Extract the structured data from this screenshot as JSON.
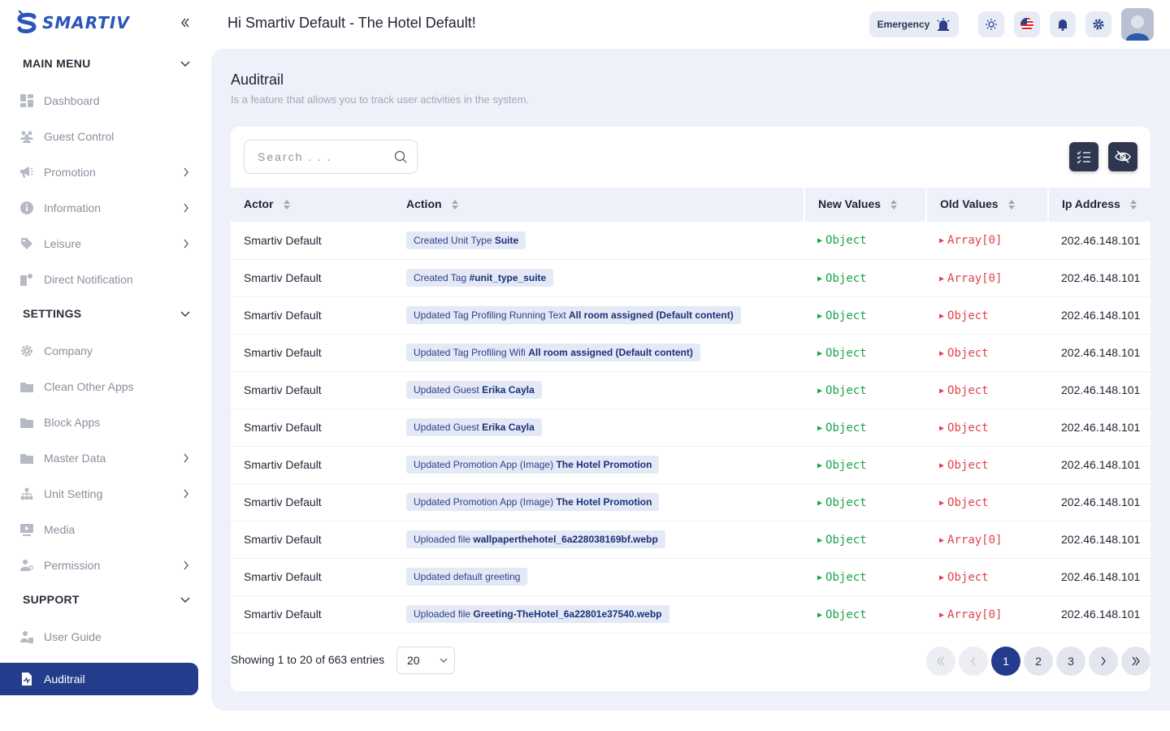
{
  "app": {
    "logo_text": "SMARTIV",
    "brand_color": "#233d8c"
  },
  "header": {
    "greeting": "Hi Smartiv Default - The Hotel Default!",
    "emergency_label": "Emergency"
  },
  "sidebar": {
    "sections": [
      {
        "title": "MAIN MENU",
        "items": [
          {
            "label": "Dashboard",
            "icon": "dashboard-icon",
            "has_chevron": false
          },
          {
            "label": "Guest Control",
            "icon": "users-icon",
            "has_chevron": false
          },
          {
            "label": "Promotion",
            "icon": "megaphone-icon",
            "has_chevron": true
          },
          {
            "label": "Information",
            "icon": "info-icon",
            "has_chevron": true
          },
          {
            "label": "Leisure",
            "icon": "tag-icon",
            "has_chevron": true
          },
          {
            "label": "Direct Notification",
            "icon": "notification-icon",
            "has_chevron": false
          }
        ]
      },
      {
        "title": "SETTINGS",
        "items": [
          {
            "label": "Company",
            "icon": "gear-icon",
            "has_chevron": false
          },
          {
            "label": "Clean Other Apps",
            "icon": "folder-icon",
            "has_chevron": false
          },
          {
            "label": "Block Apps",
            "icon": "folder-icon",
            "has_chevron": false
          },
          {
            "label": "Master Data",
            "icon": "folder-icon",
            "has_chevron": true
          },
          {
            "label": "Unit Setting",
            "icon": "hierarchy-icon",
            "has_chevron": true
          },
          {
            "label": "Media",
            "icon": "media-icon",
            "has_chevron": false
          },
          {
            "label": "Permission",
            "icon": "user-key-icon",
            "has_chevron": true
          }
        ]
      },
      {
        "title": "SUPPORT",
        "items": [
          {
            "label": "User Guide",
            "icon": "user-guide-icon",
            "has_chevron": false
          }
        ]
      }
    ],
    "active_item": {
      "label": "Auditrail",
      "icon": "auditrail-icon"
    }
  },
  "page": {
    "title": "Auditrail",
    "subtitle": "Is a feature that allows you to track user activities in the system."
  },
  "search": {
    "placeholder": "Search . . ."
  },
  "table": {
    "columns": [
      "Actor",
      "Action",
      "New Values",
      "Old Values",
      "Ip Address"
    ],
    "rows": [
      {
        "actor": "Smartiv Default",
        "action_prefix": "Created Unit Type ",
        "action_bold": "Suite",
        "new_value": "Object",
        "old_value": "Array[0]",
        "ip": "202.46.148.101"
      },
      {
        "actor": "Smartiv Default",
        "action_prefix": "Created Tag ",
        "action_bold": "#unit_type_suite",
        "new_value": "Object",
        "old_value": "Array[0]",
        "ip": "202.46.148.101"
      },
      {
        "actor": "Smartiv Default",
        "action_prefix": "Updated Tag Profiling Running Text ",
        "action_bold": "All room assigned (Default content)",
        "new_value": "Object",
        "old_value": "Object",
        "ip": "202.46.148.101"
      },
      {
        "actor": "Smartiv Default",
        "action_prefix": "Updated Tag Profiling Wifi ",
        "action_bold": "All room assigned (Default content)",
        "new_value": "Object",
        "old_value": "Object",
        "ip": "202.46.148.101"
      },
      {
        "actor": "Smartiv Default",
        "action_prefix": "Updated Guest ",
        "action_bold": "Erika Cayla",
        "new_value": "Object",
        "old_value": "Object",
        "ip": "202.46.148.101"
      },
      {
        "actor": "Smartiv Default",
        "action_prefix": "Updated Guest ",
        "action_bold": "Erika Cayla",
        "new_value": "Object",
        "old_value": "Object",
        "ip": "202.46.148.101"
      },
      {
        "actor": "Smartiv Default",
        "action_prefix": "Updated Promotion App (Image) ",
        "action_bold": "The Hotel Promotion",
        "new_value": "Object",
        "old_value": "Object",
        "ip": "202.46.148.101"
      },
      {
        "actor": "Smartiv Default",
        "action_prefix": "Updated Promotion App (Image) ",
        "action_bold": "The Hotel Promotion",
        "new_value": "Object",
        "old_value": "Object",
        "ip": "202.46.148.101"
      },
      {
        "actor": "Smartiv Default",
        "action_prefix": "Uploaded file ",
        "action_bold": "wallpaperthehotel_6a228038169bf.webp",
        "new_value": "Object",
        "old_value": "Array[0]",
        "ip": "202.46.148.101"
      },
      {
        "actor": "Smartiv Default",
        "action_prefix": "Updated default greeting",
        "action_bold": "",
        "new_value": "Object",
        "old_value": "Object",
        "ip": "202.46.148.101"
      },
      {
        "actor": "Smartiv Default",
        "action_prefix": "Uploaded file ",
        "action_bold": "Greeting-TheHotel_6a22801e37540.webp",
        "new_value": "Object",
        "old_value": "Array[0]",
        "ip": "202.46.148.101"
      }
    ]
  },
  "pagination": {
    "info": "Showing 1 to 20 of 663 entries",
    "page_size": "20",
    "pages": [
      "1",
      "2",
      "3"
    ],
    "current": "1"
  }
}
